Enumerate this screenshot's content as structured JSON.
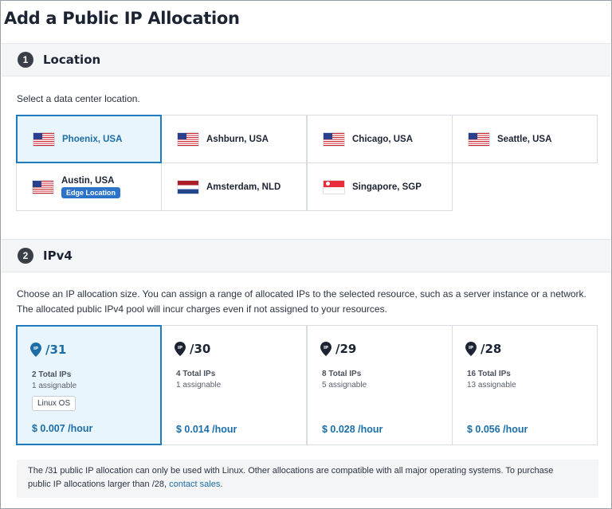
{
  "page": {
    "title": "Add a Public IP Allocation"
  },
  "location_section": {
    "step": "1",
    "title": "Location",
    "description": "Select a data center location.",
    "locations": [
      {
        "name": "Phoenix, USA",
        "flag": "us-flag-icon",
        "selected": true
      },
      {
        "name": "Ashburn, USA",
        "flag": "us-flag-icon"
      },
      {
        "name": "Chicago, USA",
        "flag": "us-flag-icon"
      },
      {
        "name": "Seattle, USA",
        "flag": "us-flag-icon"
      },
      {
        "name": "Austin, USA",
        "flag": "us-flag-icon",
        "badge": "Edge Location"
      },
      {
        "name": "Amsterdam, NLD",
        "flag": "nl-flag-icon"
      },
      {
        "name": "Singapore, SGP",
        "flag": "sg-flag-icon"
      }
    ]
  },
  "ipv4_section": {
    "step": "2",
    "title": "IPv4",
    "description_line1": "Choose an IP allocation size. You can assign a range of allocated IPs to the selected resource, such as a server instance or a network.",
    "description_line2": "The allocated public IPv4 pool will incur charges even if not assigned to your resources.",
    "allocations": [
      {
        "prefix": "/31",
        "total": "2 Total IPs",
        "assignable": "1 assignable",
        "os_tag": "Linux OS",
        "price": "$ 0.007 /hour",
        "selected": true
      },
      {
        "prefix": "/30",
        "total": "4 Total IPs",
        "assignable": "1 assignable",
        "price": "$ 0.014 /hour"
      },
      {
        "prefix": "/29",
        "total": "8 Total IPs",
        "assignable": "5 assignable",
        "price": "$ 0.028 /hour"
      },
      {
        "prefix": "/28",
        "total": "16 Total IPs",
        "assignable": "13 assignable",
        "price": "$ 0.056 /hour"
      }
    ],
    "note_line1": "The /31 public IP allocation can only be used with Linux. Other allocations are compatible with all major operating systems. To purchase",
    "note_line2_prefix": "public IP allocations larger than /28, ",
    "note_link": "contact sales",
    "note_line2_suffix": "."
  },
  "colors": {
    "accent": "#1e7bbf",
    "selected_bg": "#e9f5fc",
    "arrow": "#e8373b",
    "badge": "#2d73c7"
  }
}
